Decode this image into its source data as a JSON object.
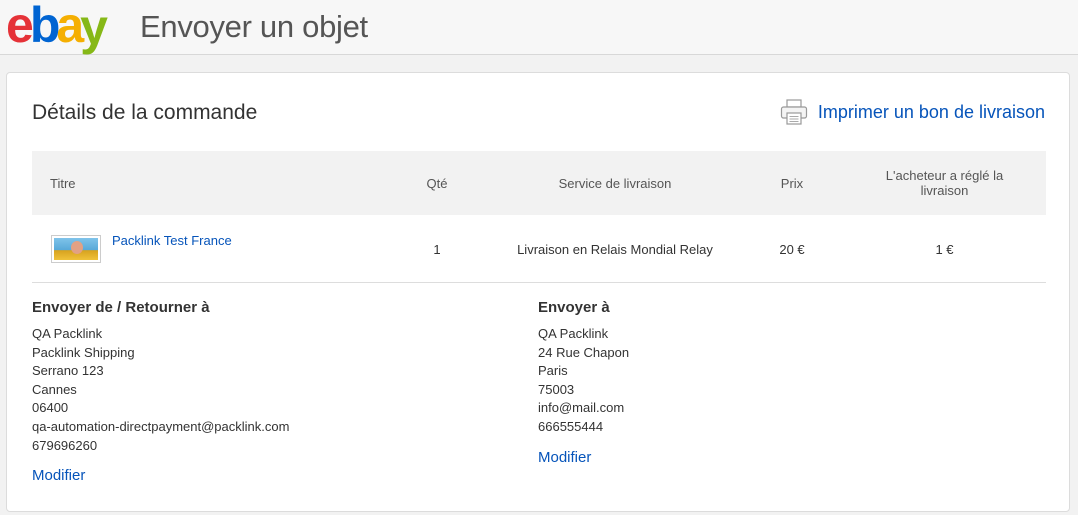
{
  "header": {
    "logo": [
      "e",
      "b",
      "a",
      "y"
    ],
    "title": "Envoyer un objet"
  },
  "order": {
    "section_title": "Détails de la commande",
    "print_label": "Imprimer un bon de livraison",
    "print_icon": "printer-icon",
    "columns": {
      "title": "Titre",
      "qty": "Qté",
      "service": "Service de livraison",
      "price": "Prix",
      "buyer_paid": "L'acheteur a réglé la livraison"
    },
    "item": {
      "title": "Packlink Test France",
      "qty": "1",
      "service": "Livraison en Relais Mondial Relay",
      "price": "20 €",
      "buyer_paid": "1 €"
    }
  },
  "sender": {
    "heading": "Envoyer de / Retourner à",
    "lines": [
      "QA Packlink",
      "Packlink Shipping",
      "Serrano 123",
      "Cannes",
      "06400",
      "qa-automation-directpayment@packlink.com",
      "679696260"
    ],
    "modify_label": "Modifier"
  },
  "recipient": {
    "heading": "Envoyer à",
    "lines": [
      "QA Packlink",
      "24 Rue Chapon",
      "Paris",
      "75003",
      "info@mail.com",
      "666555444"
    ],
    "modify_label": "Modifier"
  }
}
